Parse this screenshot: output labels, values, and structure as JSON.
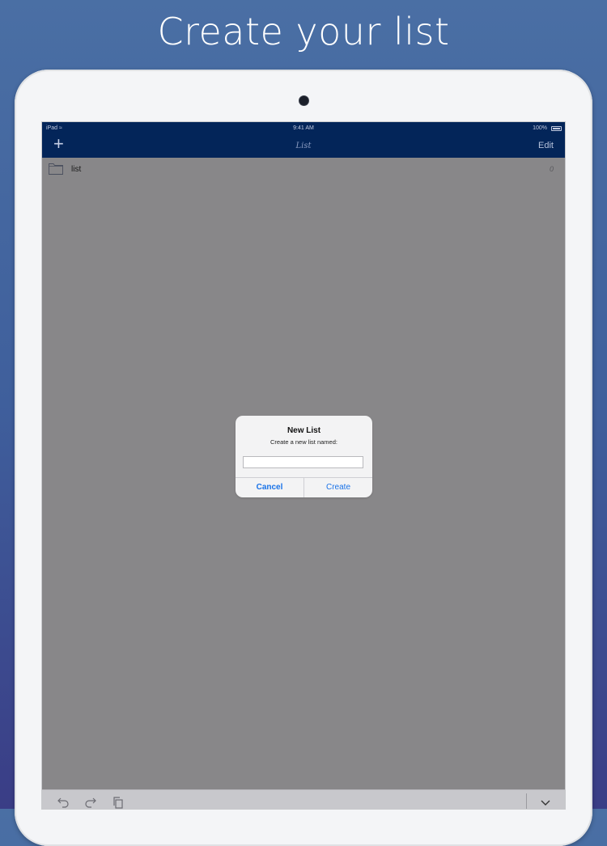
{
  "headline": "Create your list",
  "status_bar": {
    "device": "iPad",
    "time": "9:41 AM",
    "battery": "100%"
  },
  "nav_bar": {
    "add_label": "+",
    "title": "List",
    "edit_label": "Edit"
  },
  "lists": [
    {
      "name": "list",
      "count": "0"
    }
  ],
  "alert": {
    "title": "New List",
    "message": "Create a new list named:",
    "input_value": "",
    "input_placeholder": "",
    "cancel_label": "Cancel",
    "create_label": "Create"
  },
  "toolbar": {
    "icons": [
      "undo-icon",
      "redo-icon",
      "copy-icon",
      "chevron-down-icon"
    ]
  },
  "colors": {
    "nav_bar": "#032559",
    "screen_dim": "#888789",
    "alert_button": "#1a73e8",
    "background_top": "#4a6fa4",
    "background_bottom": "#3a3d86"
  }
}
